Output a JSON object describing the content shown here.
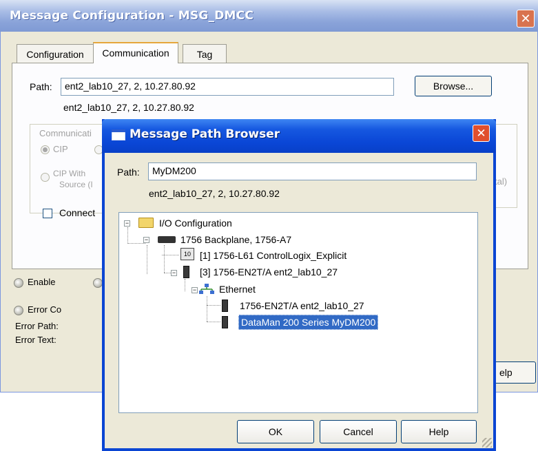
{
  "back_window": {
    "title": "Message Configuration - MSG_DMCC",
    "close_glyph": "✕",
    "tabs": [
      {
        "label": "Configuration",
        "active": false
      },
      {
        "label": "Communication",
        "active": true
      },
      {
        "label": "Tag",
        "active": false
      }
    ],
    "path_label": "Path:",
    "path_value": "ent2_lab10_27, 2, 10.27.80.92",
    "path_resolved": "ent2_lab10_27, 2, 10.27.80.92",
    "browse_label": "Browse...",
    "comm_group_label": "Communicati",
    "cip_label": "CIP",
    "cip_with_source_line1": "CIP With",
    "cip_with_source_line2": "Source (I",
    "right_fragment": "tal)",
    "connected_label": "Connect",
    "enable_label": "Enable",
    "error_label": "Error Co",
    "error_path_label": "Error Path:",
    "error_text_label": "Error Text:",
    "help_fragment": "elp"
  },
  "front_dialog": {
    "title": "Message Path Browser",
    "close_glyph": "✕",
    "path_label": "Path:",
    "path_value": "MyDM200",
    "path_resolved": "ent2_lab10_27, 2, 10.27.80.92",
    "tree": {
      "root": "I/O Configuration",
      "backplane": "1756 Backplane, 1756-A7",
      "slot1": "[1] 1756-L61 ControlLogix_Explicit",
      "slot3": "[3] 1756-EN2T/A ent2_lab10_27",
      "ethernet": "Ethernet",
      "eth_item1": "1756-EN2T/A ent2_lab10_27",
      "eth_item2_selected": "DataMan 200 Series MyDM200"
    },
    "buttons": {
      "ok": "OK",
      "cancel": "Cancel",
      "help": "Help"
    }
  }
}
